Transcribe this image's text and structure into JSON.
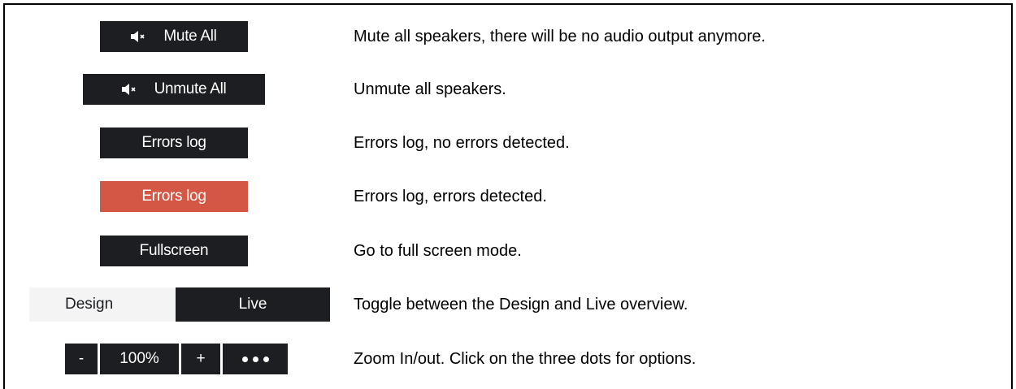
{
  "rows": [
    {
      "button_label": "Mute All",
      "icon": "speaker-mute-icon",
      "description": "Mute all speakers, there will be no audio output anymore."
    },
    {
      "button_label": "Unmute All",
      "icon": "speaker-mute-icon",
      "description": "Unmute all speakers."
    },
    {
      "button_label": "Errors log",
      "description": "Errors log, no errors detected."
    },
    {
      "button_label": "Errors log",
      "description": "Errors log, errors detected."
    },
    {
      "button_label": "Fullscreen",
      "description": "Go to full screen mode."
    },
    {
      "toggle": {
        "design_label": "Design",
        "live_label": "Live"
      },
      "description": "Toggle between the Design and Live overview."
    },
    {
      "zoom": {
        "minus_label": "-",
        "value": "100%",
        "plus_label": "+",
        "options_icon": "more-dots-icon"
      },
      "description": "Zoom In/out. Click on the three dots for options."
    }
  ],
  "colors": {
    "button_dark": "#1c1e22",
    "button_error": "#d45645",
    "toggle_background": "#f4f4f4"
  }
}
